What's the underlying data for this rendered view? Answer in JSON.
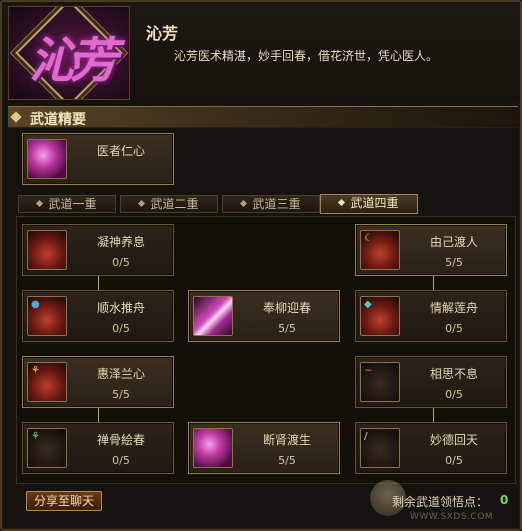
{
  "header": {
    "logo_text": "沁芳",
    "name": "沁芳",
    "description": "沁芳医术精湛，妙手回春，借花济世，凭心医人。"
  },
  "section": {
    "title": "武道精要"
  },
  "core_skill": {
    "name": "医者仁心",
    "icon": "heart-lotus-icon"
  },
  "tabs": [
    {
      "label": "武道一重"
    },
    {
      "label": "武道二重"
    },
    {
      "label": "武道三重"
    },
    {
      "label": "武道四重"
    }
  ],
  "selected_tab": "武道四重",
  "skills": [
    {
      "name": "凝神养息",
      "level": "0/5",
      "icon": "red-scroll-icon"
    },
    {
      "name": "由己渡人",
      "level": "5/5",
      "icon": "crescent-icon"
    },
    {
      "name": "顺水推舟",
      "level": "0/5",
      "icon": "blue-orb-icon"
    },
    {
      "name": "奉柳迎春",
      "level": "5/5",
      "icon": "magic-staff-icon"
    },
    {
      "name": "情解莲舟",
      "level": "0/5",
      "icon": "teal-flame-icon"
    },
    {
      "name": "惠泽兰心",
      "level": "5/5",
      "icon": "orchid-icon"
    },
    {
      "name": "相思不息",
      "level": "0/5",
      "icon": "red-swirl-icon"
    },
    {
      "name": "禅骨絵春",
      "level": "0/5",
      "icon": "green-spirit-icon"
    },
    {
      "name": "断肾渡生",
      "level": "5/5",
      "icon": "pink-blossom-icon"
    },
    {
      "name": "妙德回天",
      "level": "0/5",
      "icon": "blade-icon"
    }
  ],
  "footer": {
    "share_label": "分享至聊天",
    "points_label": "剩余武道领悟点：",
    "points_value": "0"
  },
  "watermark": {
    "url": "WWW.SXDS.COM"
  },
  "colors": {
    "accent_gold": "#e0c78a",
    "points_green": "#7bd85a",
    "logo_magenta": "#e06ad0"
  }
}
